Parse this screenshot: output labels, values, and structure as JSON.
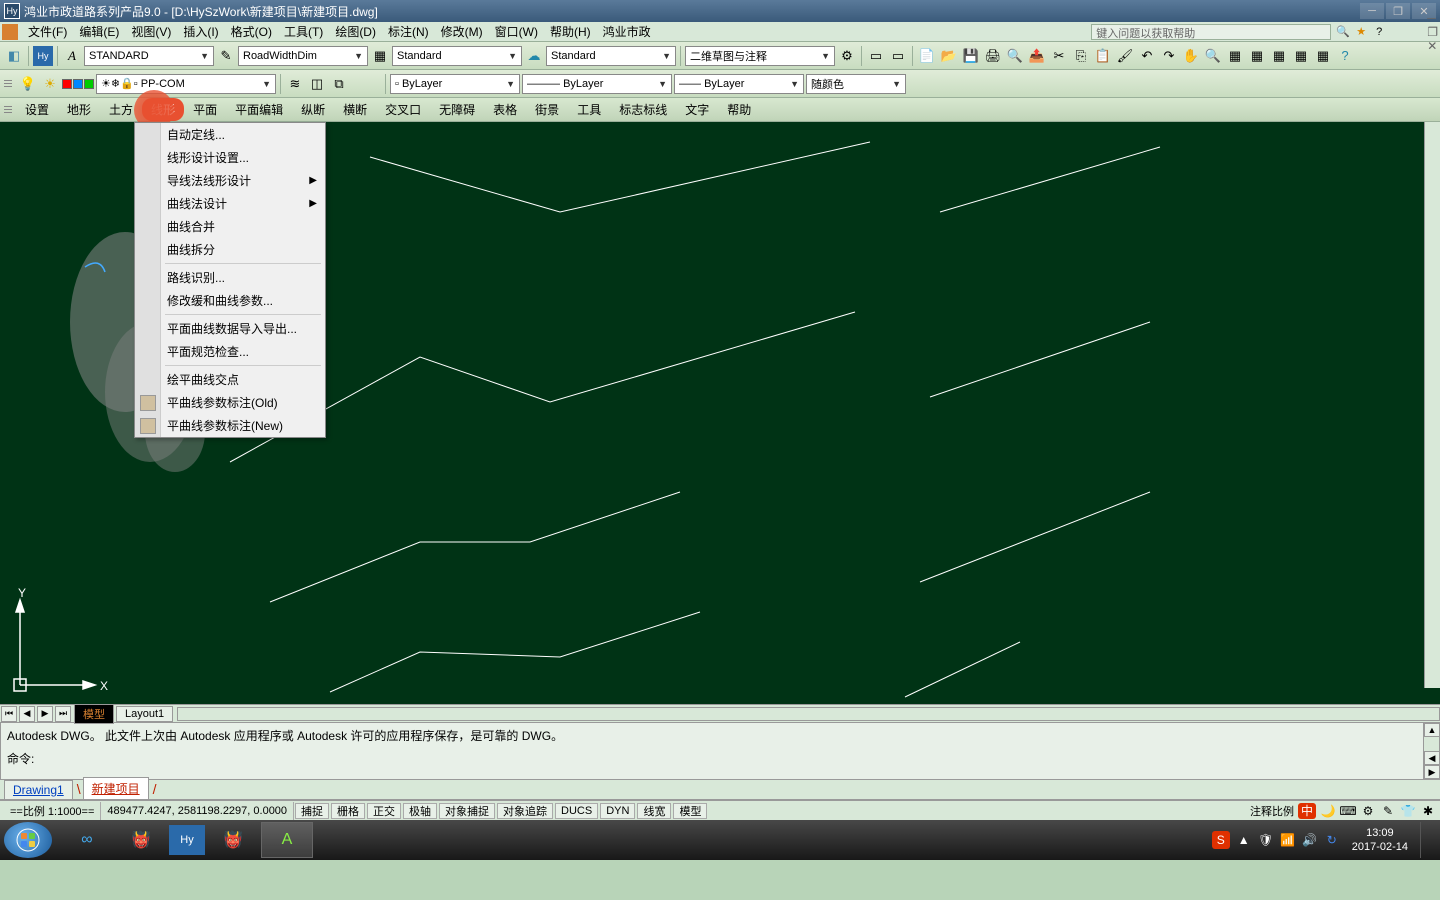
{
  "titlebar": {
    "app_icon": "Hy",
    "title": "鸿业市政道路系列产品9.0  - [D:\\HySzWork\\新建项目\\新建项目.dwg]"
  },
  "menubar": {
    "items": [
      "文件(F)",
      "编辑(E)",
      "视图(V)",
      "插入(I)",
      "格式(O)",
      "工具(T)",
      "绘图(D)",
      "标注(N)",
      "修改(M)",
      "窗口(W)",
      "帮助(H)",
      "鸿业市政"
    ],
    "search_placeholder": "键入问题以获取帮助"
  },
  "toolbar1": {
    "combo1": "STANDARD",
    "combo2": "RoadWidthDim",
    "combo3": "Standard",
    "combo4": "Standard",
    "combo5": "二维草图与注释"
  },
  "toolbar2": {
    "combo_layer": "PP-COM",
    "combo_color": "ByLayer",
    "combo_ltype": "ByLayer",
    "combo_lweight": "ByLayer",
    "combo_plot": "随颜色"
  },
  "secmenu": {
    "items": [
      "设置",
      "地形",
      "土方",
      "线形",
      "平面",
      "平面编辑",
      "纵断",
      "横断",
      "交叉口",
      "无障碍",
      "表格",
      "街景",
      "工具",
      "标志标线",
      "文字",
      "帮助"
    ],
    "active_index": 3
  },
  "dropdown": {
    "items": [
      {
        "label": "自动定线...",
        "icon": false
      },
      {
        "label": "线形设计设置...",
        "icon": false
      },
      {
        "label": "导线法线形设计",
        "icon": false,
        "sub": true
      },
      {
        "label": "曲线法设计",
        "icon": false,
        "sub": true
      },
      {
        "label": "曲线合并",
        "icon": false
      },
      {
        "label": "曲线拆分",
        "icon": false
      },
      {
        "sep": true
      },
      {
        "label": "路线识别...",
        "icon": false
      },
      {
        "label": "修改缓和曲线参数...",
        "icon": false
      },
      {
        "sep": true
      },
      {
        "label": "平面曲线数据导入导出...",
        "icon": false
      },
      {
        "label": "平面规范检查...",
        "icon": false
      },
      {
        "sep": true
      },
      {
        "label": "绘平曲线交点",
        "icon": false
      },
      {
        "label": "平曲线参数标注(Old)",
        "icon": true
      },
      {
        "label": "平曲线参数标注(New)",
        "icon": true
      }
    ]
  },
  "ucs": {
    "x": "X",
    "y": "Y"
  },
  "layout_tabs": {
    "model": "模型",
    "layout1": "Layout1"
  },
  "command": {
    "line1": "Autodesk DWG。  此文件上次由 Autodesk 应用程序或 Autodesk 许可的应用程序保存，是可靠的 DWG。",
    "prompt": "命令:"
  },
  "doctabs": {
    "tab1": "Drawing1",
    "tab2": "新建项目"
  },
  "status": {
    "scale": "==比例 1:1000==",
    "coords": "489477.4247, 2581198.2297, 0.0000",
    "buttons": [
      "捕捉",
      "栅格",
      "正交",
      "极轴",
      "对象捕捉",
      "对象追踪",
      "DUCS",
      "DYN",
      "线宽",
      "模型"
    ],
    "right_label": "注释比例",
    "ime": "中"
  },
  "taskbar": {
    "clock_time": "13:09",
    "clock_date": "2017-02-14"
  }
}
